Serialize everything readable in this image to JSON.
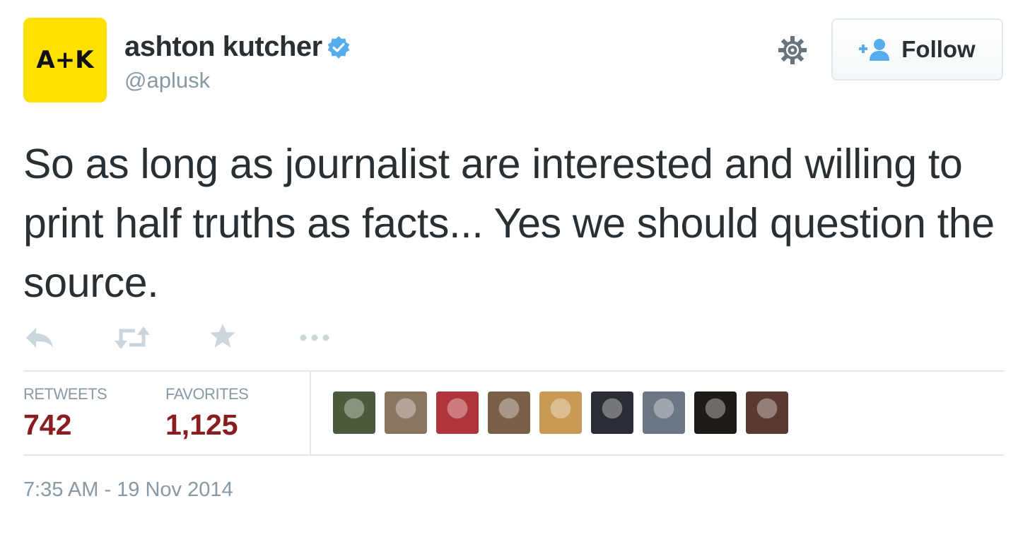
{
  "user": {
    "avatar_text": "A+K",
    "display_name": "ashton kutcher",
    "screen_name": "@aplusk",
    "verified_icon": "verified-badge-icon"
  },
  "header": {
    "settings_icon": "gear-icon",
    "follow_label": "Follow",
    "follow_icon": "add-person-icon"
  },
  "tweet": {
    "text": "So as long as journalist are interested and willing to print half truths as facts... Yes we should question the source.",
    "timestamp": "7:35 AM - 19 Nov 2014"
  },
  "actions": [
    "reply-icon",
    "retweet-icon",
    "favorite-star-icon",
    "more-dots-icon"
  ],
  "stats": {
    "retweets_label": "RETWEETS",
    "retweets_value": "742",
    "favorites_label": "FAVORITES",
    "favorites_value": "1,125"
  },
  "favoriters": [
    {
      "name": "favoriter-avatar-1",
      "color": "#4a5a3a"
    },
    {
      "name": "favoriter-avatar-2",
      "color": "#8a7560"
    },
    {
      "name": "favoriter-avatar-3",
      "color": "#b0353a"
    },
    {
      "name": "favoriter-avatar-4",
      "color": "#7a6048"
    },
    {
      "name": "favoriter-avatar-5",
      "color": "#c89a55"
    },
    {
      "name": "favoriter-avatar-6",
      "color": "#2a2d33"
    },
    {
      "name": "favoriter-avatar-7",
      "color": "#6d7683"
    },
    {
      "name": "favoriter-avatar-8",
      "color": "#1f1a17"
    },
    {
      "name": "favoriter-avatar-9",
      "color": "#5a3a30"
    }
  ],
  "colors": {
    "avatar_bg": "#ffe100",
    "verified_blue": "#55acee",
    "stat_value": "#8a1d20",
    "muted": "#8899a6",
    "action_icon": "#ccd6dd"
  }
}
